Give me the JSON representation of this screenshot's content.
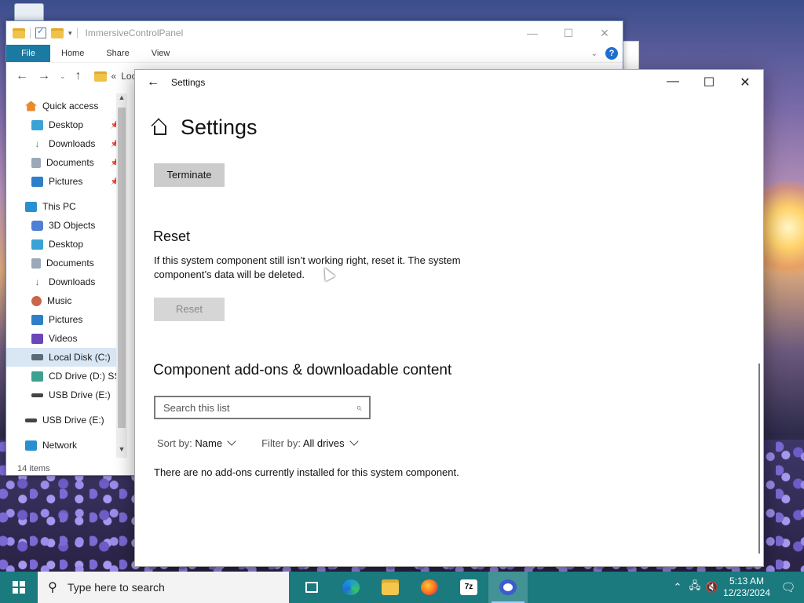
{
  "explorer": {
    "title": "ImmersiveControlPanel",
    "ribbon": {
      "file": "File",
      "home": "Home",
      "share": "Share",
      "view": "View",
      "help": "?"
    },
    "address": {
      "text": "Loc"
    },
    "nav": {
      "quick_access": "Quick access",
      "qa_items": [
        "Desktop",
        "Downloads",
        "Documents",
        "Pictures"
      ],
      "this_pc": "This PC",
      "pc_items": [
        "3D Objects",
        "Desktop",
        "Documents",
        "Downloads",
        "Music",
        "Pictures",
        "Videos",
        "Local Disk (C:)",
        "CD Drive (D:) SSS",
        "USB Drive (E:)"
      ],
      "usb": "USB Drive (E:)",
      "network": "Network"
    },
    "status": "14 items"
  },
  "settings": {
    "window_title": "Settings",
    "page_title": "Settings",
    "terminate_label": "Terminate",
    "reset_heading": "Reset",
    "reset_desc": "If this system component still isn’t working right, reset it. The system component’s data will be deleted.",
    "reset_label": "Reset",
    "addons_heading": "Component add-ons & downloadable content",
    "search_placeholder": "Search this list",
    "sort_label": "Sort by:",
    "sort_value": "Name",
    "filter_label": "Filter by:",
    "filter_value": "All drives",
    "no_addons": "There are no add-ons currently installed for this system component."
  },
  "taskbar": {
    "search_placeholder": "Type here to search",
    "time": "5:13 AM",
    "date": "12/23/2024",
    "apps": [
      "task-view",
      "edge",
      "file-explorer",
      "firefox",
      "7-zip",
      "chrome"
    ]
  },
  "colors": {
    "taskbar": "#1a7a7e",
    "file_tab": "#1a7aa3",
    "button_gray": "#cccccc"
  }
}
